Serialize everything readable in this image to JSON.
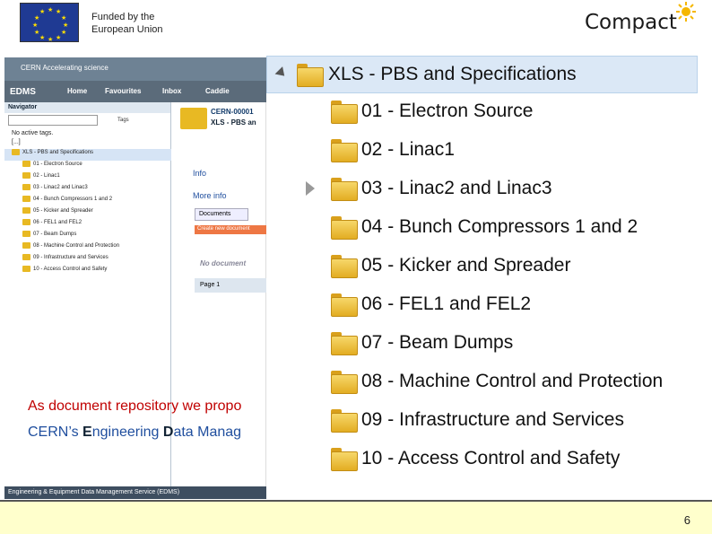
{
  "header": {
    "funded_line1": "Funded by the",
    "funded_line2": "European Union",
    "brand": "Compact"
  },
  "screenshot": {
    "cern_title": "CERN Accelerating science",
    "edms_logo": "EDMS",
    "nav_home": "Home",
    "nav_favourites": "Favourites",
    "nav_inbox": "Inbox",
    "nav_caddie": "Caddie",
    "navigator_title": "Navigator",
    "tags_label": "Tags",
    "no_active_tags": "No active tags.",
    "root_label": "[...]",
    "tree_root": "XLS - PBS and Specifications",
    "tree_items": [
      "01 - Electron Source",
      "02 - Linac1",
      "03 - Linac2 and Linac3",
      "04 - Bunch Compressors 1 and 2",
      "05 - Kicker and Spreader",
      "06 - FEL1 and FEL2",
      "07 - Beam Dumps",
      "08 - Machine Control and Protection",
      "09 - Infrastructure and Services",
      "10 - Access Control and Safety"
    ],
    "doc_id": "CERN-00001",
    "doc_title": "XLS - PBS an",
    "info_link": "Info",
    "more_info_link": "More info",
    "documents_tab": "Documents",
    "create_doc": "Create new document",
    "no_documents": "No document",
    "page_label": "Page 1",
    "footer": "Engineering & Equipment Data Management Service (EDMS)"
  },
  "caption": {
    "line1": "As document repository we propo",
    "line2_prefix": "CERN’s ",
    "line2_e": "E",
    "line2_mid": "ngineering ",
    "line2_d": "D",
    "line2_tail": "ata Manag"
  },
  "tree": {
    "root_label": "XLS - PBS and Specifications",
    "items": [
      {
        "label": "01 - Electron Source",
        "expandable": false
      },
      {
        "label": "02 - Linac1",
        "expandable": false
      },
      {
        "label": "03 - Linac2 and Linac3",
        "expandable": true
      },
      {
        "label": "04 - Bunch Compressors 1 and 2",
        "expandable": false
      },
      {
        "label": "05 - Kicker and Spreader",
        "expandable": false
      },
      {
        "label": "06 - FEL1 and FEL2",
        "expandable": false
      },
      {
        "label": "07 - Beam Dumps",
        "expandable": false
      },
      {
        "label": "08 - Machine Control and Protection",
        "expandable": false
      },
      {
        "label": "09 - Infrastructure and Services",
        "expandable": false
      },
      {
        "label": "10 - Access Control and Safety",
        "expandable": false
      }
    ]
  },
  "footer": {
    "page_number": "6"
  },
  "colors": {
    "caption_red": "#c00000",
    "caption_blue": "#1f4e9e",
    "tree_highlight": "#dbe8f6",
    "footer_bg": "#ffffcc"
  }
}
